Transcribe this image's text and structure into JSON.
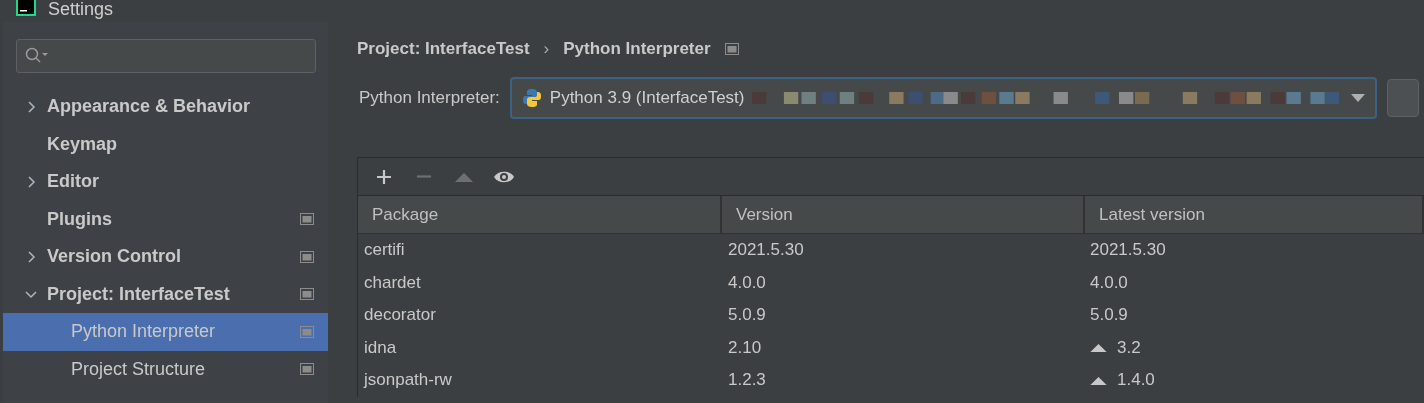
{
  "window": {
    "title": "Settings"
  },
  "sidebar": {
    "items": [
      {
        "label": "Appearance & Behavior",
        "expanded": false,
        "selected": false,
        "project_level": false
      },
      {
        "label": "Keymap",
        "selected": false,
        "project_level": false
      },
      {
        "label": "Editor",
        "expanded": false,
        "selected": false,
        "project_level": false
      },
      {
        "label": "Plugins",
        "selected": false,
        "project_level": true
      },
      {
        "label": "Version Control",
        "expanded": false,
        "selected": false,
        "project_level": true
      },
      {
        "label": "Project: InterfaceTest",
        "expanded": true,
        "selected": false,
        "project_level": true,
        "children": [
          {
            "label": "Python Interpreter",
            "selected": true,
            "project_level": true
          },
          {
            "label": "Project Structure",
            "selected": false,
            "project_level": true
          }
        ]
      }
    ]
  },
  "breadcrumb": {
    "items": [
      "Project: InterfaceTest",
      "Python Interpreter"
    ],
    "separator": "›"
  },
  "interpreter": {
    "label": "Python Interpreter:",
    "value": "Python 3.9 (InterfaceTest)"
  },
  "toolbar": [
    {
      "kind": "add",
      "disabled": false
    },
    {
      "kind": "remove",
      "disabled": true
    },
    {
      "kind": "upgrade",
      "disabled": true
    },
    {
      "kind": "show",
      "disabled": false
    }
  ],
  "table": {
    "columns": [
      "Package",
      "Version",
      "Latest version"
    ],
    "rows": [
      {
        "package": "certifi",
        "version": "2021.5.30",
        "latest": "2021.5.30",
        "upgrade": false
      },
      {
        "package": "chardet",
        "version": "4.0.0",
        "latest": "4.0.0",
        "upgrade": false
      },
      {
        "package": "decorator",
        "version": "5.0.9",
        "latest": "5.0.9",
        "upgrade": false
      },
      {
        "package": "idna",
        "version": "2.10",
        "latest": "3.2",
        "upgrade": true
      },
      {
        "package": "jsonpath-rw",
        "version": "1.2.3",
        "latest": "1.4.0",
        "upgrade": true
      }
    ]
  }
}
